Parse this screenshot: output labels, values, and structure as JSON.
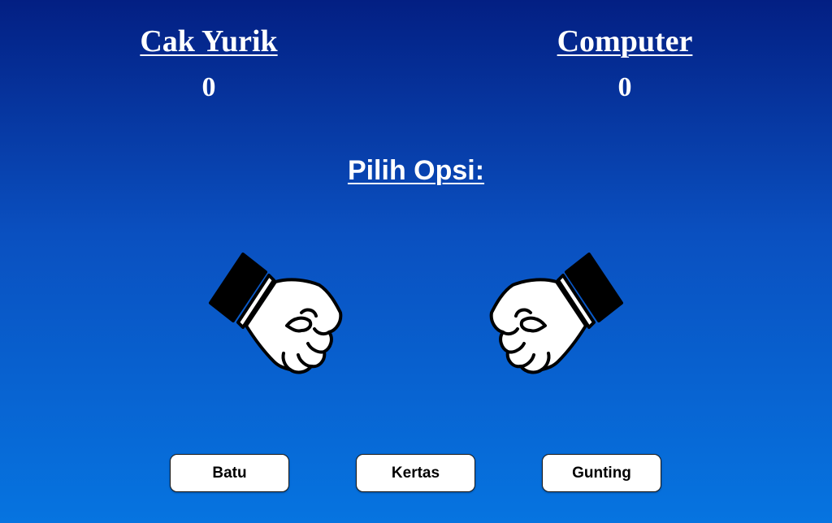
{
  "player": {
    "name": "Cak Yurik",
    "score": "0",
    "hand_icon": "fist-icon"
  },
  "computer": {
    "name": "Computer",
    "score": "0",
    "hand_icon": "fist-icon"
  },
  "prompt": "Pilih Opsi:",
  "options": {
    "batu": "Batu",
    "kertas": "Kertas",
    "gunting": "Gunting"
  },
  "colors": {
    "background_top": "#031f83",
    "background_bottom": "#0674e0",
    "text": "#ffffff",
    "button_bg": "#ffffff",
    "button_text": "#000000"
  }
}
